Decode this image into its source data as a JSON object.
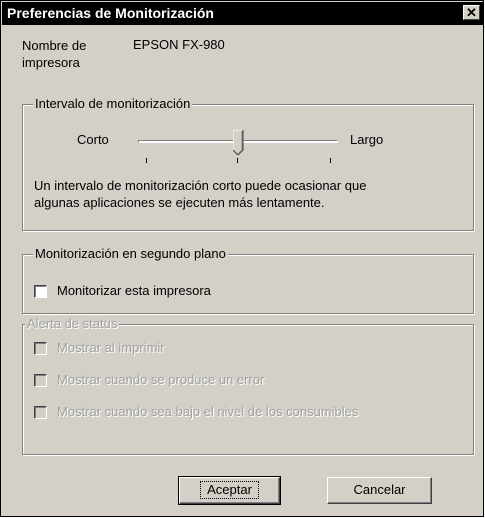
{
  "window": {
    "title": "Preferencias de Monitorización",
    "close_symbol": "✕"
  },
  "printer": {
    "name_label_line1": "Nombre de",
    "name_label_line2": "impresora",
    "name_value": "EPSON FX-980"
  },
  "interval": {
    "legend": "Intervalo de monitorización",
    "short_label": "Corto",
    "long_label": "Largo",
    "level_fraction": 0.5,
    "description_line1": "Un intervalo de monitorización corto puede ocasionar que",
    "description_line2": "algunas aplicaciones se ejecuten más lentamente."
  },
  "background": {
    "legend": "Monitorización en segundo plano",
    "monitor_checkbox_label": "Monitorizar esta impresora",
    "monitor_checked": false
  },
  "status_alert": {
    "legend": "Alerta de status",
    "items": [
      {
        "label": "Mostrar al imprimir",
        "checked": false
      },
      {
        "label": "Mostrar cuando se produce un error",
        "checked": false
      },
      {
        "label": "Mostrar cuando sea bajo el nivel de los consumibles",
        "checked": false
      }
    ]
  },
  "buttons": {
    "ok_label": "Aceptar",
    "cancel_label": "Cancelar"
  }
}
